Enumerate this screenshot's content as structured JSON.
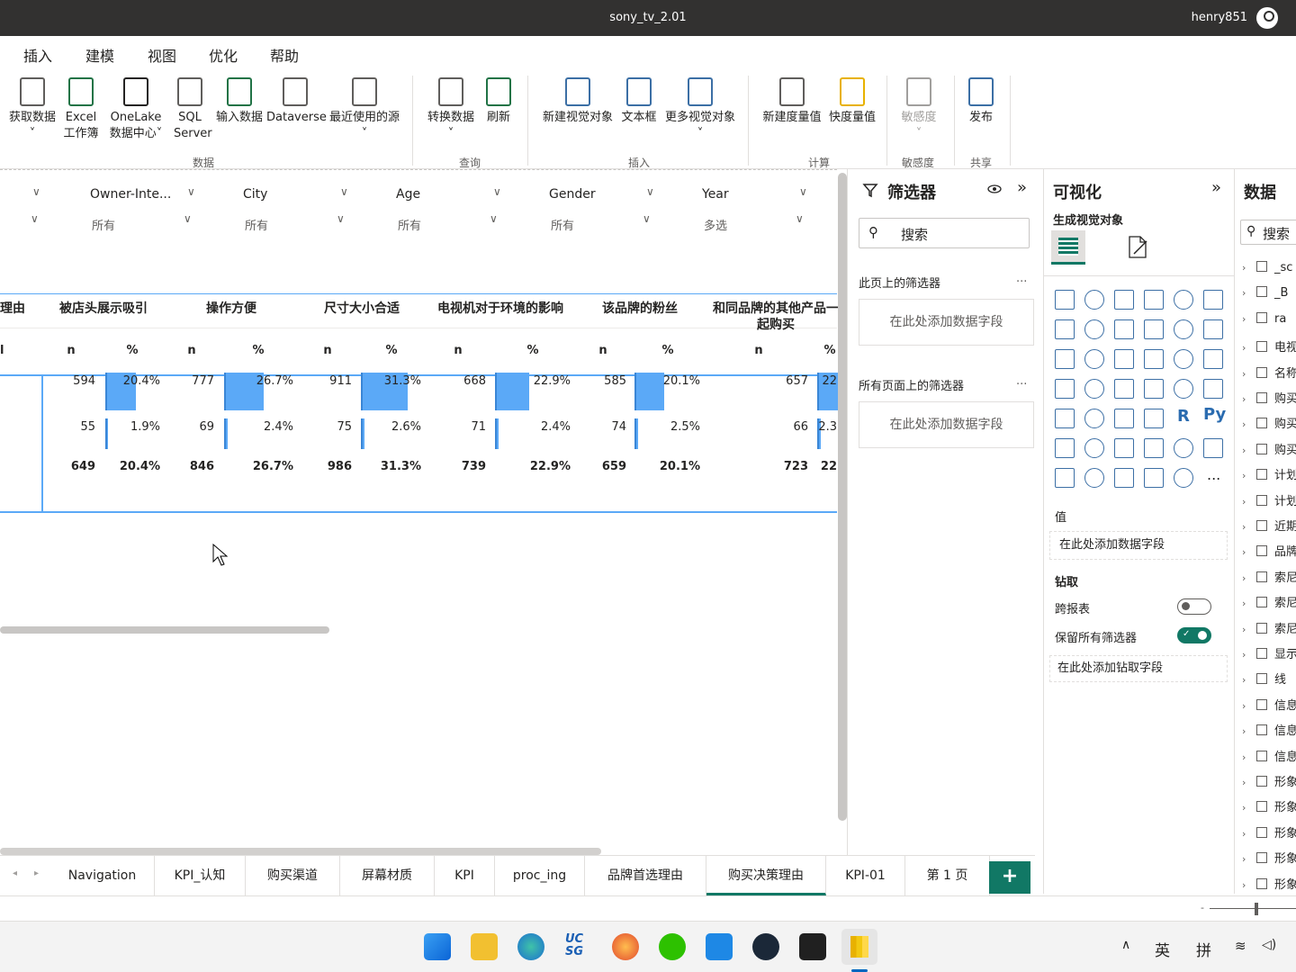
{
  "app": {
    "title": "sony_tv_2.01",
    "user": "henry851"
  },
  "menu": [
    "插入",
    "建模",
    "视图",
    "优化",
    "帮助"
  ],
  "ribbon": {
    "buttons": [
      {
        "label": "获取数据",
        "sub": "˅",
        "icon": "database-icon"
      },
      {
        "label": "Excel",
        "sub": "工作簿",
        "icon": "excel-icon"
      },
      {
        "label": "OneLake",
        "sub": "数据中心˅",
        "icon": "onelake-icon"
      },
      {
        "label": "SQL",
        "sub": "Server",
        "icon": "sql-server-icon"
      },
      {
        "label": "输入数据",
        "sub": "",
        "icon": "table-add-icon"
      },
      {
        "label": "Dataverse",
        "sub": "",
        "icon": "dataverse-icon"
      },
      {
        "label": "最近使用的源",
        "sub": "˅",
        "icon": "recent-sources-icon"
      },
      {
        "label": "转换数据",
        "sub": "˅",
        "icon": "transform-icon"
      },
      {
        "label": "刷新",
        "sub": "",
        "icon": "refresh-icon"
      },
      {
        "label": "新建视觉对象",
        "sub": "",
        "icon": "new-visual-icon"
      },
      {
        "label": "文本框",
        "sub": "",
        "icon": "textbox-icon"
      },
      {
        "label": "更多视觉对象",
        "sub": "˅",
        "icon": "more-visuals-icon"
      },
      {
        "label": "新建度量值",
        "sub": "",
        "icon": "measure-icon"
      },
      {
        "label": "快度量值",
        "sub": "",
        "icon": "quick-measure-icon"
      },
      {
        "label": "敏感度",
        "sub": "˅",
        "icon": "sensitivity-icon"
      },
      {
        "label": "发布",
        "sub": "",
        "icon": "publish-icon"
      }
    ],
    "groups": [
      "数据",
      "查询",
      "插入",
      "计算",
      "敏感度",
      "共享"
    ]
  },
  "slicers": [
    {
      "title": "Owner-Inte...",
      "value": "所有"
    },
    {
      "title": "City",
      "value": "所有"
    },
    {
      "title": "Age",
      "value": "所有"
    },
    {
      "title": "Gender",
      "value": "所有"
    },
    {
      "title": "Year",
      "value": "多选"
    }
  ],
  "table": {
    "first_header": "理由",
    "columns": [
      "被店头展示吸引",
      "操作方便",
      "尺寸大小合适",
      "电视机对于环境的影响",
      "该品牌的粉丝",
      "和同品牌的其他产品一起购买"
    ],
    "sub_n": "n",
    "sub_pct": "%",
    "rows": [
      {
        "vals": [
          [
            "594",
            "20.4%"
          ],
          [
            "777",
            "26.7%"
          ],
          [
            "911",
            "31.3%"
          ],
          [
            "668",
            "22.9%"
          ],
          [
            "585",
            "20.1%"
          ],
          [
            "657",
            "22"
          ]
        ],
        "pct": [
          20.4,
          26.7,
          31.3,
          22.9,
          20.1,
          22.6
        ]
      },
      {
        "vals": [
          [
            "55",
            "1.9%"
          ],
          [
            "69",
            "2.4%"
          ],
          [
            "75",
            "2.6%"
          ],
          [
            "71",
            "2.4%"
          ],
          [
            "74",
            "2.5%"
          ],
          [
            "66",
            "2.3"
          ]
        ],
        "pct": [
          1.9,
          2.4,
          2.6,
          2.4,
          2.5,
          2.3
        ]
      },
      {
        "vals": [
          [
            "649",
            "20.4%"
          ],
          [
            "846",
            "26.7%"
          ],
          [
            "986",
            "31.3%"
          ],
          [
            "739",
            "22.9%"
          ],
          [
            "659",
            "20.1%"
          ],
          [
            "723",
            "22"
          ]
        ],
        "pct": []
      }
    ]
  },
  "filters": {
    "title": "筛选器",
    "search": "搜索",
    "page_filters": "此页上的筛选器",
    "all_filters": "所有页面上的筛选器",
    "add_field": "在此处添加数据字段",
    "more": "..."
  },
  "viz": {
    "title": "可视化",
    "build": "生成视觉对象",
    "values": "值",
    "values_drop": "在此处添加数据字段",
    "drill": "钻取",
    "cross_report": "跨报表",
    "keep_filters": "保留所有筛选器",
    "drill_drop": "在此处添加钻取字段",
    "r": "R",
    "py": "Py",
    "more": "..."
  },
  "data": {
    "title": "数据",
    "search": "搜索",
    "items": [
      "_sc",
      "_B",
      "ra",
      "电视",
      "名称",
      "购买",
      "购买",
      "购买",
      "计划",
      "计划",
      "近期",
      "品牌",
      "索尼",
      "索尼",
      "索尼",
      "显示",
      "线",
      "信息",
      "信息",
      "信息",
      "形象",
      "形象",
      "形象",
      "形象",
      "形象"
    ]
  },
  "tabs": [
    "Navigation",
    "KPI_认知",
    "购买渠道",
    "屏幕材质",
    "KPI",
    "proc_ing",
    "品牌首选理由",
    "购买决策理由",
    "KPI-01",
    "第 1 页"
  ],
  "active_tab": "购买决策理由",
  "add_tab": "+",
  "taskbar": {
    "lang": "英",
    "ime": "拼"
  }
}
